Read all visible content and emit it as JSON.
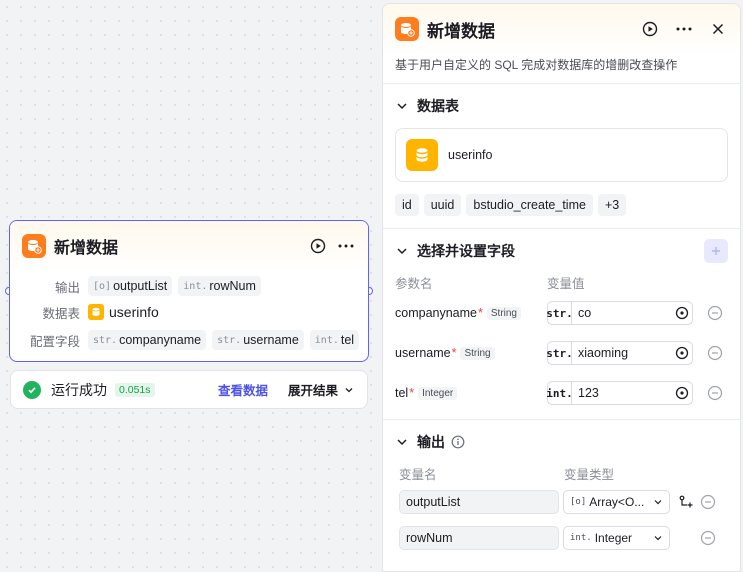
{
  "node": {
    "title": "新增数据",
    "output_label": "输出",
    "outputs": [
      {
        "type": "[o]",
        "name": "outputList"
      },
      {
        "type": "int.",
        "name": "rowNum"
      }
    ],
    "table_label": "数据表",
    "table_name": "userinfo",
    "config_label": "配置字段",
    "fields": [
      {
        "type": "str.",
        "name": "companyname"
      },
      {
        "type": "str.",
        "name": "username"
      },
      {
        "type": "int.",
        "name": "tel"
      }
    ]
  },
  "run": {
    "status": "运行成功",
    "time": "0.051s",
    "view_data": "查看数据",
    "expand": "展开结果"
  },
  "panel": {
    "title": "新增数据",
    "description": "基于用户自定义的 SQL 完成对数据库的增删改查操作",
    "table_section": "数据表",
    "table_name": "userinfo",
    "columns": [
      "id",
      "uuid",
      "bstudio_create_time",
      "+3"
    ],
    "fields_section": "选择并设置字段",
    "param_header": "参数名",
    "value_header": "变量值",
    "fields": [
      {
        "name": "companyname",
        "type": "String",
        "prefix": "str.",
        "value": "co"
      },
      {
        "name": "username",
        "type": "String",
        "prefix": "str.",
        "value": "xiaoming"
      },
      {
        "name": "tel",
        "type": "Integer",
        "prefix": "int.",
        "value": "123"
      }
    ],
    "output_section": "输出",
    "var_name_header": "变量名",
    "var_type_header": "变量类型",
    "outputs": [
      {
        "name": "outputList",
        "type_prefix": "[o]",
        "type": "Array<O..."
      },
      {
        "name": "rowNum",
        "type_prefix": "int.",
        "type": "Integer"
      }
    ]
  },
  "colors": {
    "accent": "#4d53e8",
    "node_border": "#5e62f6",
    "node_icon": "#ff7d1f",
    "db_icon": "#ffb400",
    "success": "#22b35e",
    "required": "#f33e3e"
  }
}
